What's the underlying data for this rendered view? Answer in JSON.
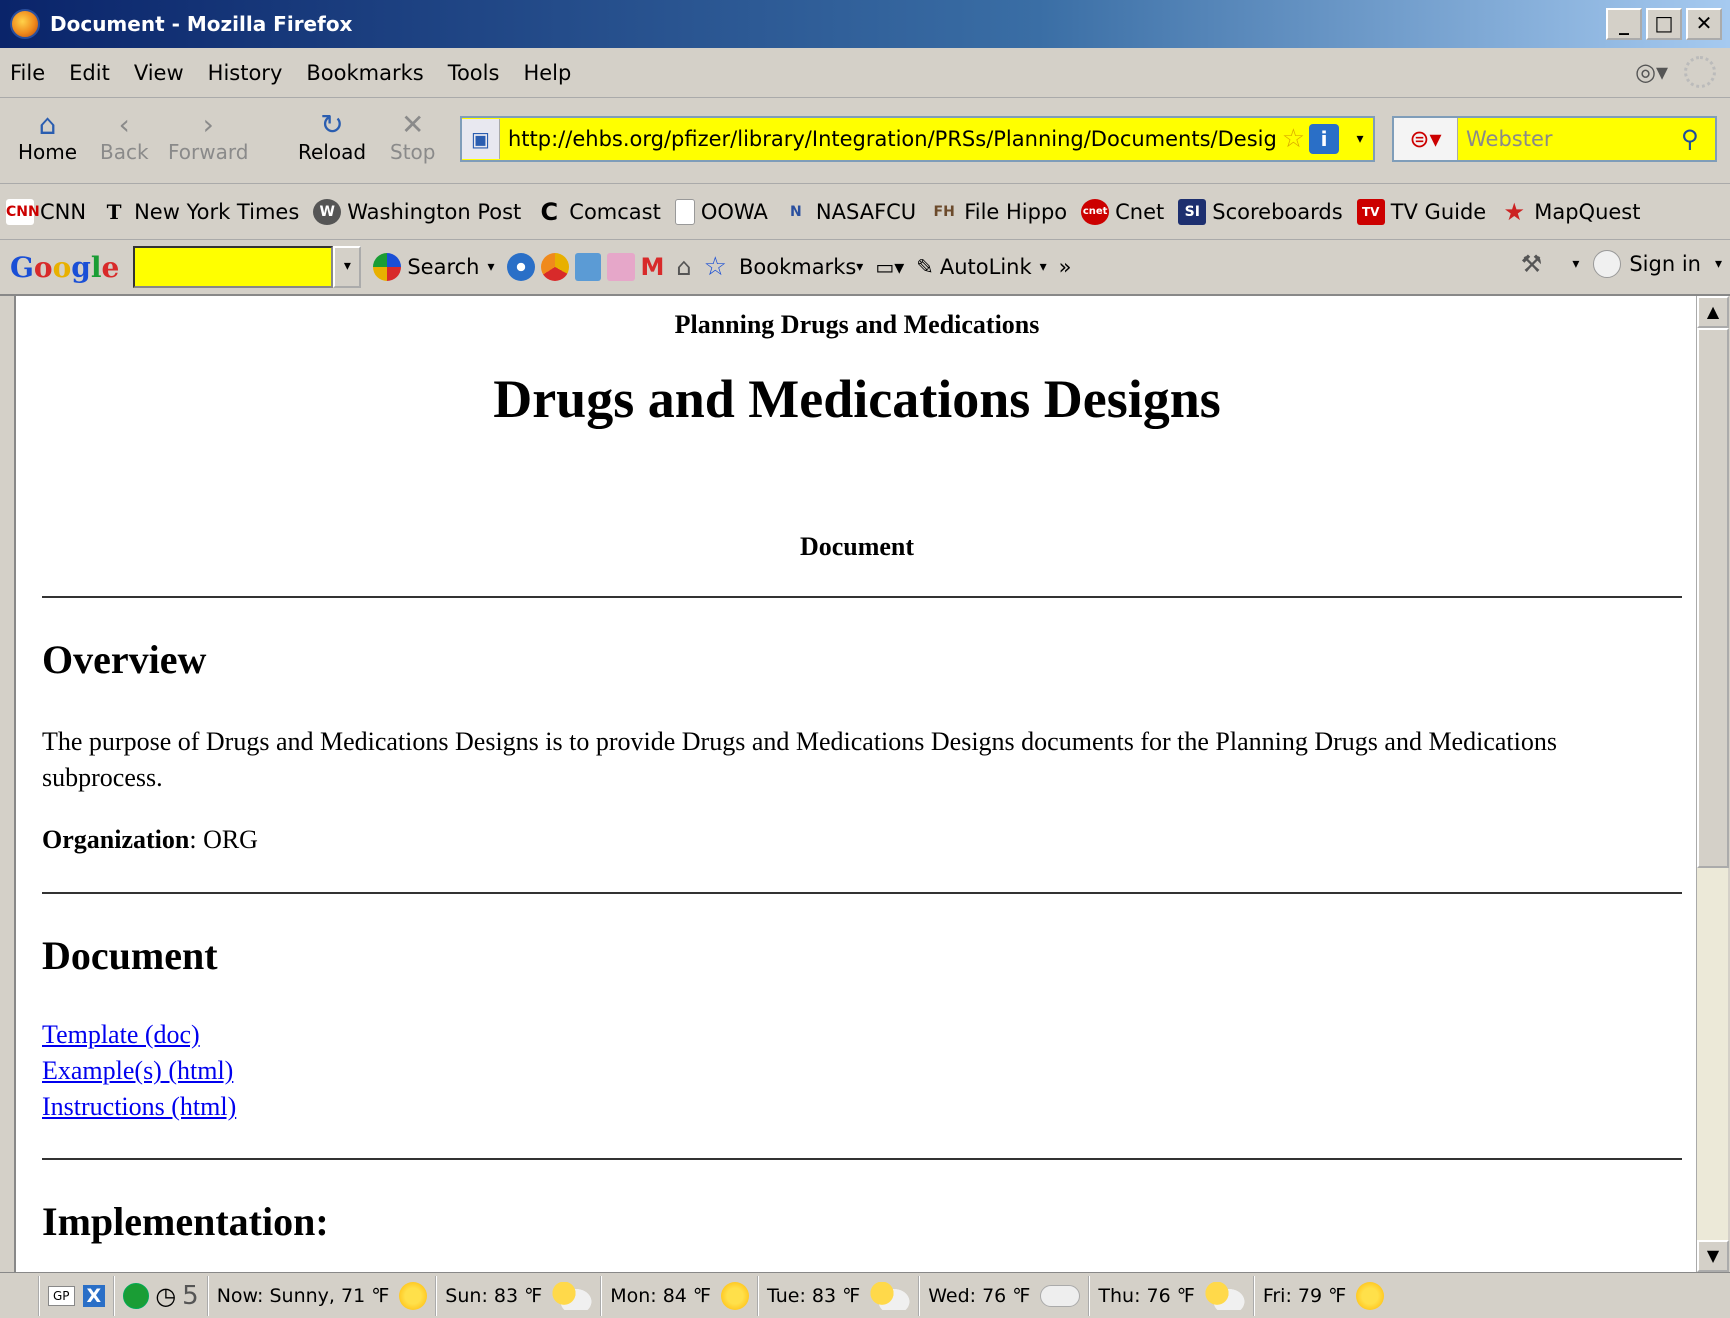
{
  "window": {
    "title": "Document - Mozilla Firefox",
    "min": "_",
    "max": "□",
    "close": "✕"
  },
  "menu": [
    "File",
    "Edit",
    "View",
    "History",
    "Bookmarks",
    "Tools",
    "Help"
  ],
  "nav": {
    "home": "Home",
    "back": "Back",
    "forward": "Forward",
    "reload": "Reload",
    "stop": "Stop",
    "url": "http://ehbs.org/pfizer/library/Integration/PRSs/Planning/Documents/Designs",
    "search_placeholder": "Webster"
  },
  "bookmarks": [
    {
      "label": "CNN",
      "icon": "CNN",
      "color": "#cc0000"
    },
    {
      "label": "New York Times",
      "icon": "T",
      "color": "#000000"
    },
    {
      "label": "Washington Post",
      "icon": "W",
      "color": "#444444"
    },
    {
      "label": "Comcast",
      "icon": "C",
      "color": "#000000"
    },
    {
      "label": "OOWA",
      "icon": "",
      "color": "#ffffff"
    },
    {
      "label": "NASAFCU",
      "icon": "N",
      "color": "#2a4f9e"
    },
    {
      "label": "File Hippo",
      "icon": "FH",
      "color": "#6b4a2b"
    },
    {
      "label": "Cnet",
      "icon": "cnet",
      "color": "#cc0000"
    },
    {
      "label": "Scoreboards",
      "icon": "SI",
      "color": "#1d2f6f"
    },
    {
      "label": "TV Guide",
      "icon": "TV",
      "color": "#cc0000"
    },
    {
      "label": "MapQuest",
      "icon": "★",
      "color": "#cc2222"
    }
  ],
  "gtoolbar": {
    "search_label": "Search",
    "bookmarks_label": "Bookmarks",
    "autolink_label": "AutoLink",
    "more": "»",
    "signin_label": "Sign in"
  },
  "page": {
    "section_name": "Planning Drugs and Medications",
    "title": "Drugs and Medications Designs",
    "subtitle": "Document",
    "overview_heading": "Overview",
    "overview_text": "The purpose of Drugs and Medications Designs is to provide Drugs and Medications Designs documents for the Planning Drugs and Medications subprocess.",
    "org_label": "Organization",
    "org_value": ": ORG",
    "document_heading": "Document",
    "links": [
      "Template (doc)",
      "Example(s) (html)",
      "Instructions (html)"
    ],
    "implementation_heading": "Implementation:"
  },
  "status": {
    "gp": "GP",
    "count": "5",
    "weather": [
      {
        "text": "Now: Sunny, 71 ℉",
        "icon": "sun"
      },
      {
        "text": "Sun: 83 ℉",
        "icon": "partly-cloudy"
      },
      {
        "text": "Mon: 84 ℉",
        "icon": "sun"
      },
      {
        "text": "Tue: 83 ℉",
        "icon": "partly-cloudy"
      },
      {
        "text": "Wed: 76 ℉",
        "icon": "cloud"
      },
      {
        "text": "Thu: 76 ℉",
        "icon": "partly-cloudy"
      },
      {
        "text": "Fri: 79 ℉",
        "icon": "sun"
      }
    ]
  }
}
